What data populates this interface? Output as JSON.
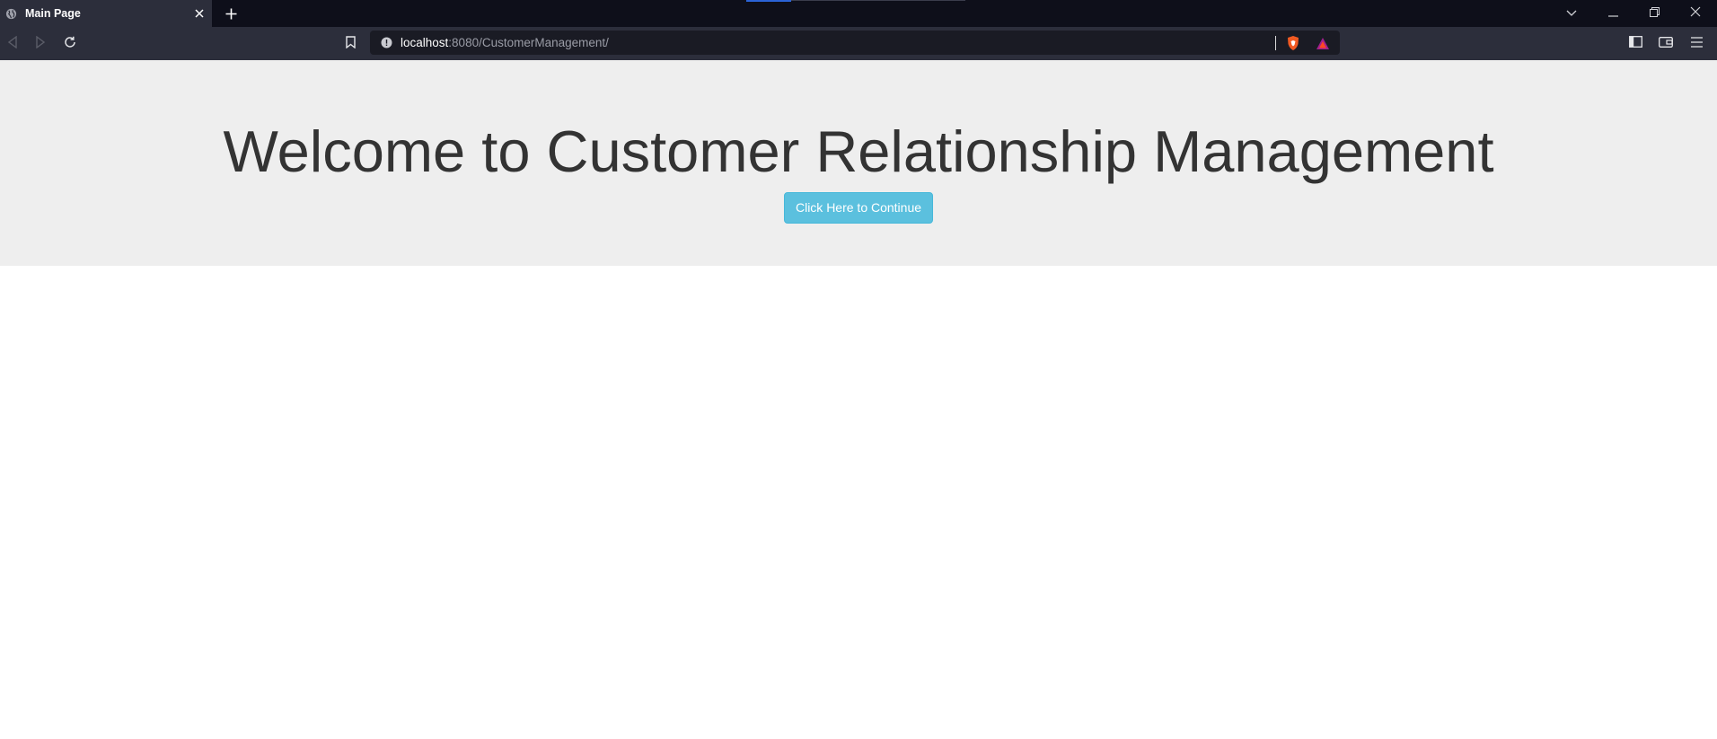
{
  "browser": {
    "tab": {
      "title": "Main Page",
      "icon": "globe-icon",
      "close_icon": "close-icon"
    },
    "new_tab_icon": "plus-icon",
    "window_controls": [
      "chevron-down-icon",
      "minimize-icon",
      "restore-icon",
      "close-icon"
    ],
    "address_bar": {
      "host": "localhost",
      "rest": ":8080/CustomerManagement/"
    }
  },
  "page": {
    "heading": "Welcome to Customer Relationship Management",
    "continue_button": "Click Here to Continue",
    "colors": {
      "jumbotron_bg": "#eeeeee",
      "button_bg": "#5bc0de",
      "heading_text": "#333333"
    }
  }
}
